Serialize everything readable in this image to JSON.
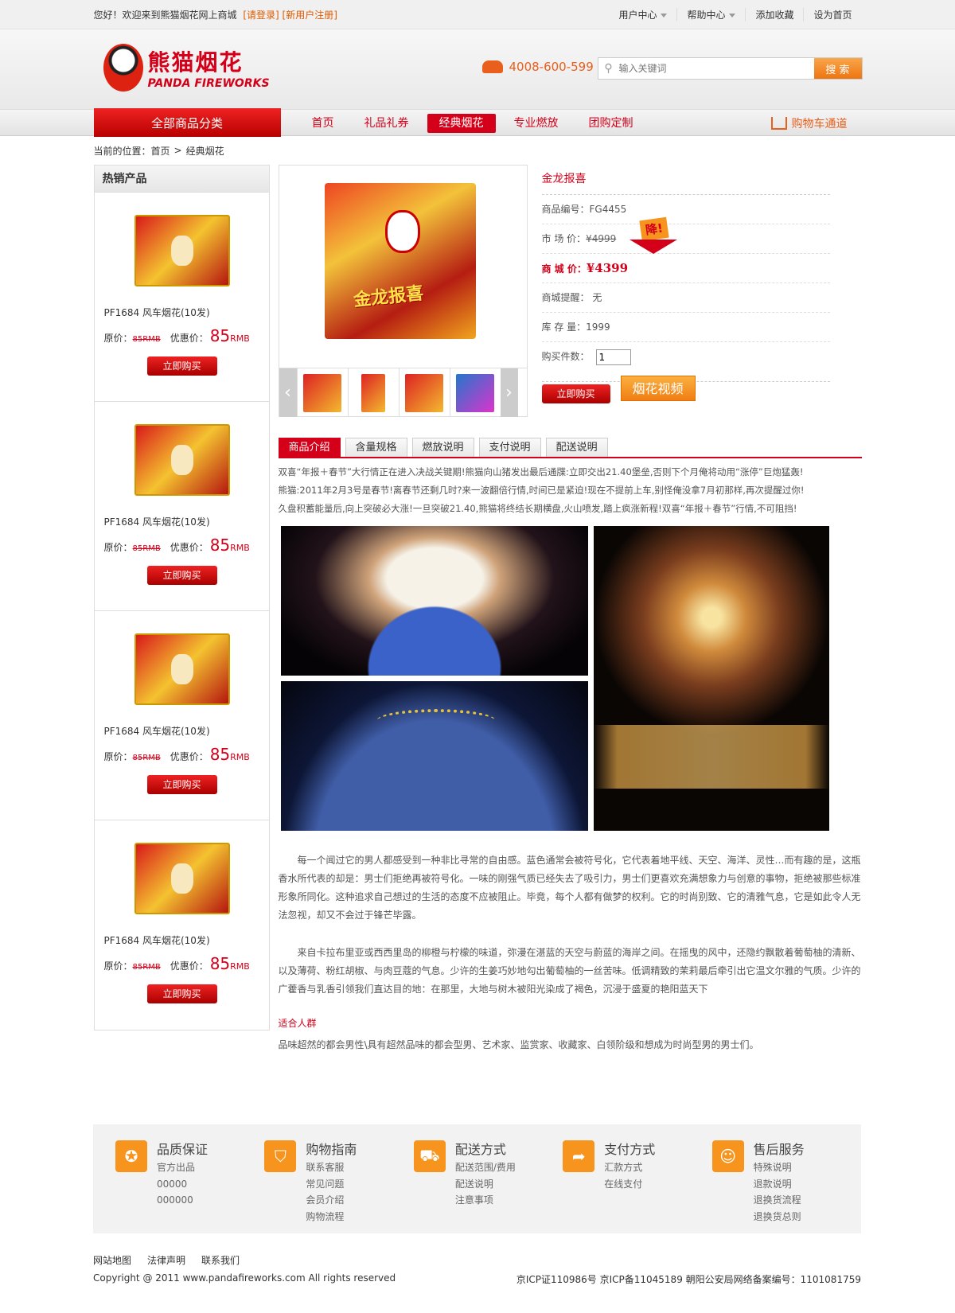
{
  "topbar": {
    "welcome": "您好！欢迎来到熊猫烟花网上商城",
    "login": "[请登录]",
    "register": "[新用户注册]",
    "menu": [
      "用户中心",
      "帮助中心",
      "添加收藏",
      "设为首页"
    ]
  },
  "header": {
    "logo_cn": "熊猫烟花",
    "logo_en": "PANDA FIREWORKS",
    "phone": "4008-600-599",
    "search_placeholder": "输入关键词",
    "search_button": "搜 索"
  },
  "nav": {
    "category_button": "全部商品分类",
    "items": [
      "首页",
      "礼品礼券",
      "经典烟花",
      "专业燃放",
      "团购定制"
    ],
    "active": "经典烟花",
    "cart": "购物车通道"
  },
  "breadcrumb": {
    "label": "当前的位置：",
    "home": "首页",
    "sep": ">",
    "current": "经典烟花"
  },
  "sidebar": {
    "title": "热销产品",
    "products": [
      {
        "name": "PF1684 风车烟花(10发)",
        "orig_label": "原价：",
        "orig_price": "85RMB",
        "sale_label": "优惠价：",
        "sale_price": "85",
        "unit": "RMB",
        "buy": "立即购买"
      },
      {
        "name": "PF1684 风车烟花(10发)",
        "orig_label": "原价：",
        "orig_price": "85RMB",
        "sale_label": "优惠价：",
        "sale_price": "85",
        "unit": "RMB",
        "buy": "立即购买"
      },
      {
        "name": "PF1684 风车烟花(10发)",
        "orig_label": "原价：",
        "orig_price": "85RMB",
        "sale_label": "优惠价：",
        "sale_price": "85",
        "unit": "RMB",
        "buy": "立即购买"
      },
      {
        "name": "PF1684 风车烟花(10发)",
        "orig_label": "原价：",
        "orig_price": "85RMB",
        "sale_label": "优惠价：",
        "sale_price": "85",
        "unit": "RMB",
        "buy": "立即购买"
      }
    ]
  },
  "product": {
    "image_label": "金龙报喜",
    "title": "金龙报喜",
    "sku_label": "商品编号：",
    "sku": "FG4455",
    "market_label": "市 场 价：",
    "market_price": "¥4999",
    "drop_tag": "降!",
    "mall_label": "商 城 价：",
    "mall_price": "¥4399",
    "notice_label": "商城提醒：",
    "notice": "无",
    "stock_label": "库 存 量：",
    "stock": "1999",
    "qty_label": "购买件数：",
    "qty": "1",
    "buy": "立即购买",
    "video": "烟花视频"
  },
  "tabs": [
    "商品介绍",
    "含量规格",
    "燃放说明",
    "支付说明",
    "配送说明"
  ],
  "description": {
    "lines": [
      "双喜“年报＋春节”大行情正在进入决战关键期!熊猫向山猪发出最后通牒:立即交出21.40堡垒,否则下个月俺将动用“涨停”巨炮猛轰!",
      "熊猫:2011年2月3号是春节!离春节还剩几时?来一波翻倍行情,时间已是紧迫!现在不提前上车,别怪俺没拿7月初那样,再次提醒过你!",
      "久盘积蓄能量后,向上突破必大涨!一旦突破21.40,熊猫将终结长期横盘,火山喷发,踏上疯涨新程!双喜“年报＋春节”行情,不可阻挡!"
    ],
    "para1": "每一个闻过它的男人都感受到一种非比寻常的自由感。蓝色通常会被符号化，它代表着地平线、天空、海洋、灵性…而有趣的是，这瓶香水所代表的却是：男士们拒绝再被符号化。一味的刚强气质已经失去了吸引力，男士们更喜欢充满想象力与创意的事物，拒绝被那些标准形象所同化。这种追求自己想过的生活的态度不应被阻止。毕竟，每个人都有做梦的权利。它的时尚别致、它的清雅气息，它是如此令人无法忽视，却又不会过于锋芒毕露。",
    "para2": "来自卡拉布里亚或西西里岛的柳橙与柠檬的味道，弥漫在湛蓝的天空与蔚蓝的海岸之间。在摇曳的风中，还隐约飘散着葡萄柚的清新、以及薄荷、粉红胡椒、与肉豆蔻的气息。少许的生姜巧妙地勾出葡萄柚的一丝苦味。低调精致的茉莉最后牵引出它温文尔雅的气质。少许的广藿香与乳香引领我们直达目的地：在那里，大地与树木被阳光染成了褐色，沉浸于盛夏的艳阳蓝天下",
    "fit_title": "适合人群",
    "fit_text": "品味超然的都会男性\\具有超然品味的都会型男、艺术家、监赏家、收藏家、白领阶级和想成为时尚型男的男士们。"
  },
  "services": [
    {
      "icon": "badge-icon",
      "glyph": "✪",
      "title": "品质保证",
      "items": [
        "官方出品",
        "00000",
        "000000"
      ]
    },
    {
      "icon": "basket-icon",
      "glyph": "⛉",
      "title": "购物指南",
      "items": [
        "联系客服",
        "常见问题",
        "会员介绍",
        "购物流程"
      ]
    },
    {
      "icon": "truck-icon",
      "glyph": "⛟",
      "title": "配送方式",
      "items": [
        "配送范围/费用",
        "配送说明",
        "注意事项"
      ]
    },
    {
      "icon": "arrow-icon",
      "glyph": "➦",
      "title": "支付方式",
      "items": [
        "汇款方式",
        "在线支付"
      ]
    },
    {
      "icon": "smile-icon",
      "glyph": "☺",
      "title": "售后服务",
      "items": [
        "特殊说明",
        "退款说明",
        "退换货流程",
        "退换货总则"
      ]
    }
  ],
  "footer": {
    "links": [
      "网站地图",
      "法律声明",
      "联系我们"
    ],
    "copyright": "Copyright @ 2011 www.pandafireworks.com All rights reserved",
    "icp": "京ICP证110986号 京ICP备11045189  朝阳公安局网络备案编号：1101081759"
  }
}
